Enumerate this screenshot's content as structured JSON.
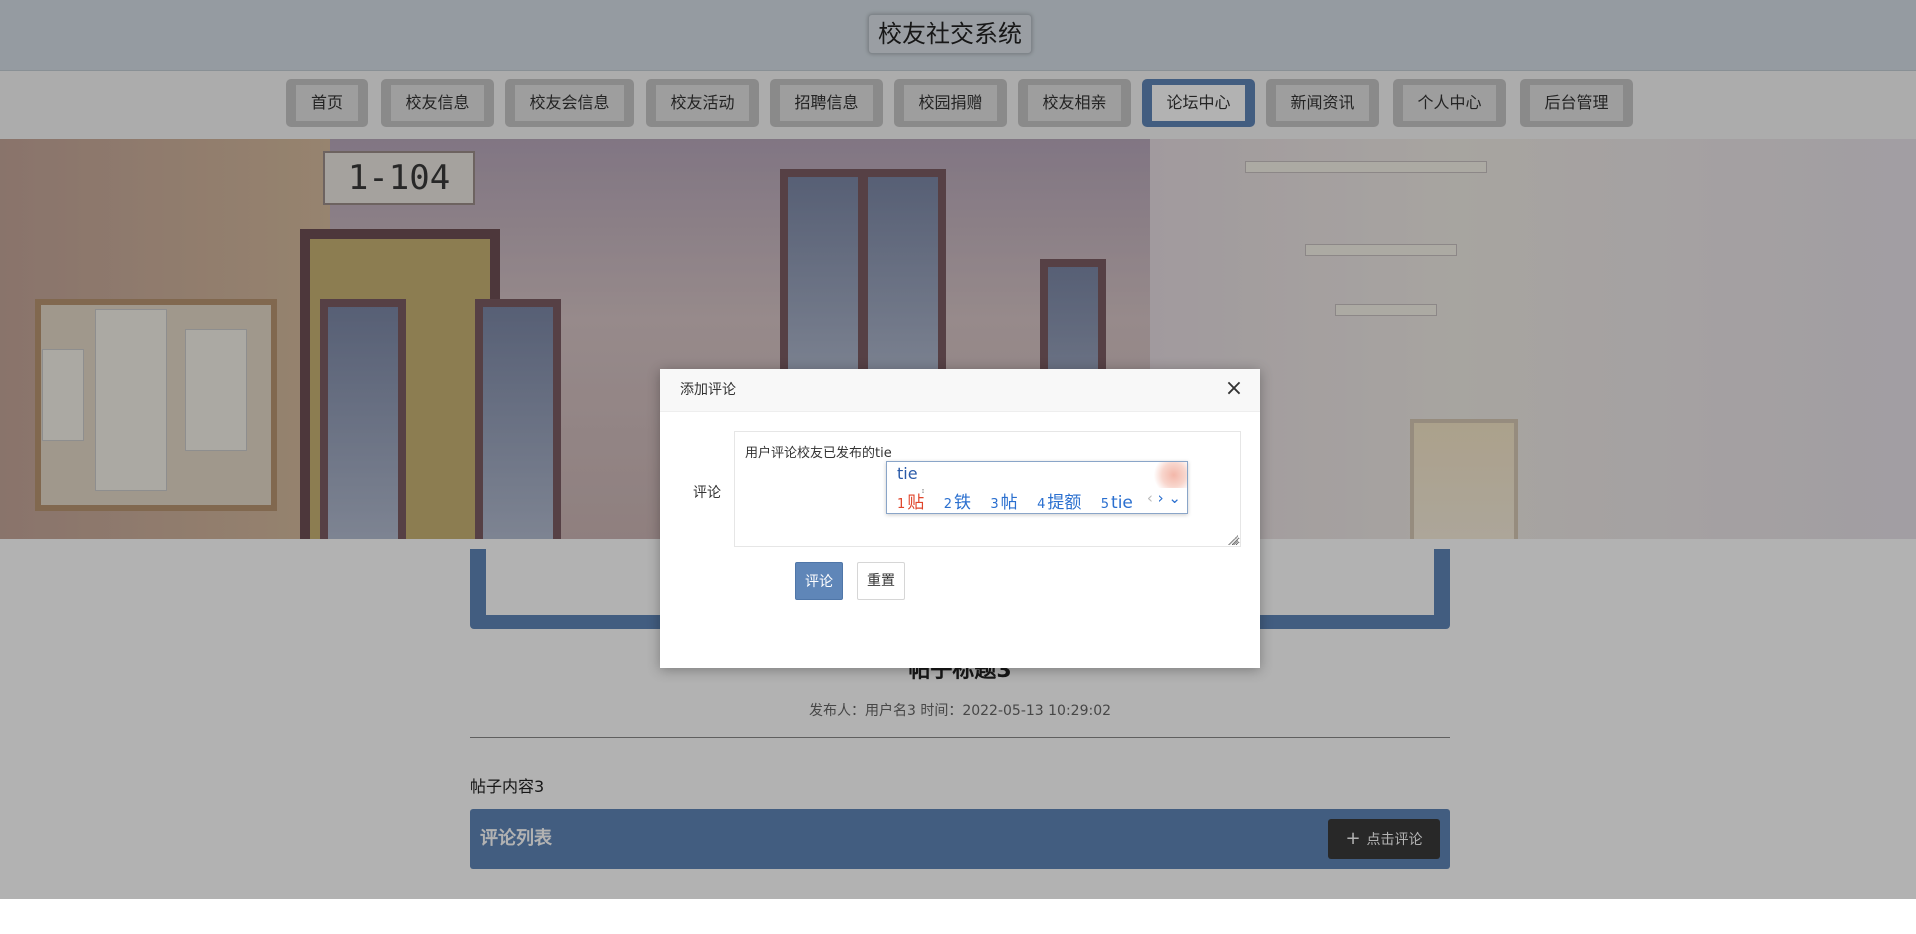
{
  "header": {
    "title": "校友社交系统"
  },
  "nav": {
    "items": [
      {
        "label": "首页",
        "active": false
      },
      {
        "label": "校友信息",
        "active": false
      },
      {
        "label": "校友会信息",
        "active": false
      },
      {
        "label": "校友活动",
        "active": false
      },
      {
        "label": "招聘信息",
        "active": false
      },
      {
        "label": "校园捐赠",
        "active": false
      },
      {
        "label": "校友相亲",
        "active": false
      },
      {
        "label": "论坛中心",
        "active": true
      },
      {
        "label": "新闻资讯",
        "active": false
      },
      {
        "label": "个人中心",
        "active": false
      },
      {
        "label": "后台管理",
        "active": false
      }
    ]
  },
  "banner": {
    "room_sign": "1-104"
  },
  "post": {
    "title": "帖子标题3",
    "meta": "发布人：用户名3 时间：2022-05-13 10:29:02",
    "content": "帖子内容3"
  },
  "comments": {
    "header": "评论列表",
    "add_button": "点击评论"
  },
  "modal": {
    "title": "添加评论",
    "field_label": "评论",
    "textarea_value": "用户评论校友已发布的tie",
    "submit_label": "评论",
    "reset_label": "重置"
  },
  "ime": {
    "composition": "tie",
    "candidates": [
      {
        "num": "1",
        "text": "贴"
      },
      {
        "num": "2",
        "text": "铁"
      },
      {
        "num": "3",
        "text": "帖"
      },
      {
        "num": "4",
        "text": "提额"
      },
      {
        "num": "5",
        "text": "tie"
      }
    ],
    "nav_prev": "‹",
    "nav_next": "›",
    "nav_expand": "⌄"
  },
  "colors": {
    "accent": "#5f86b8",
    "ime_selected": "#e0452b",
    "ime_candidate": "#2a6fcf"
  }
}
